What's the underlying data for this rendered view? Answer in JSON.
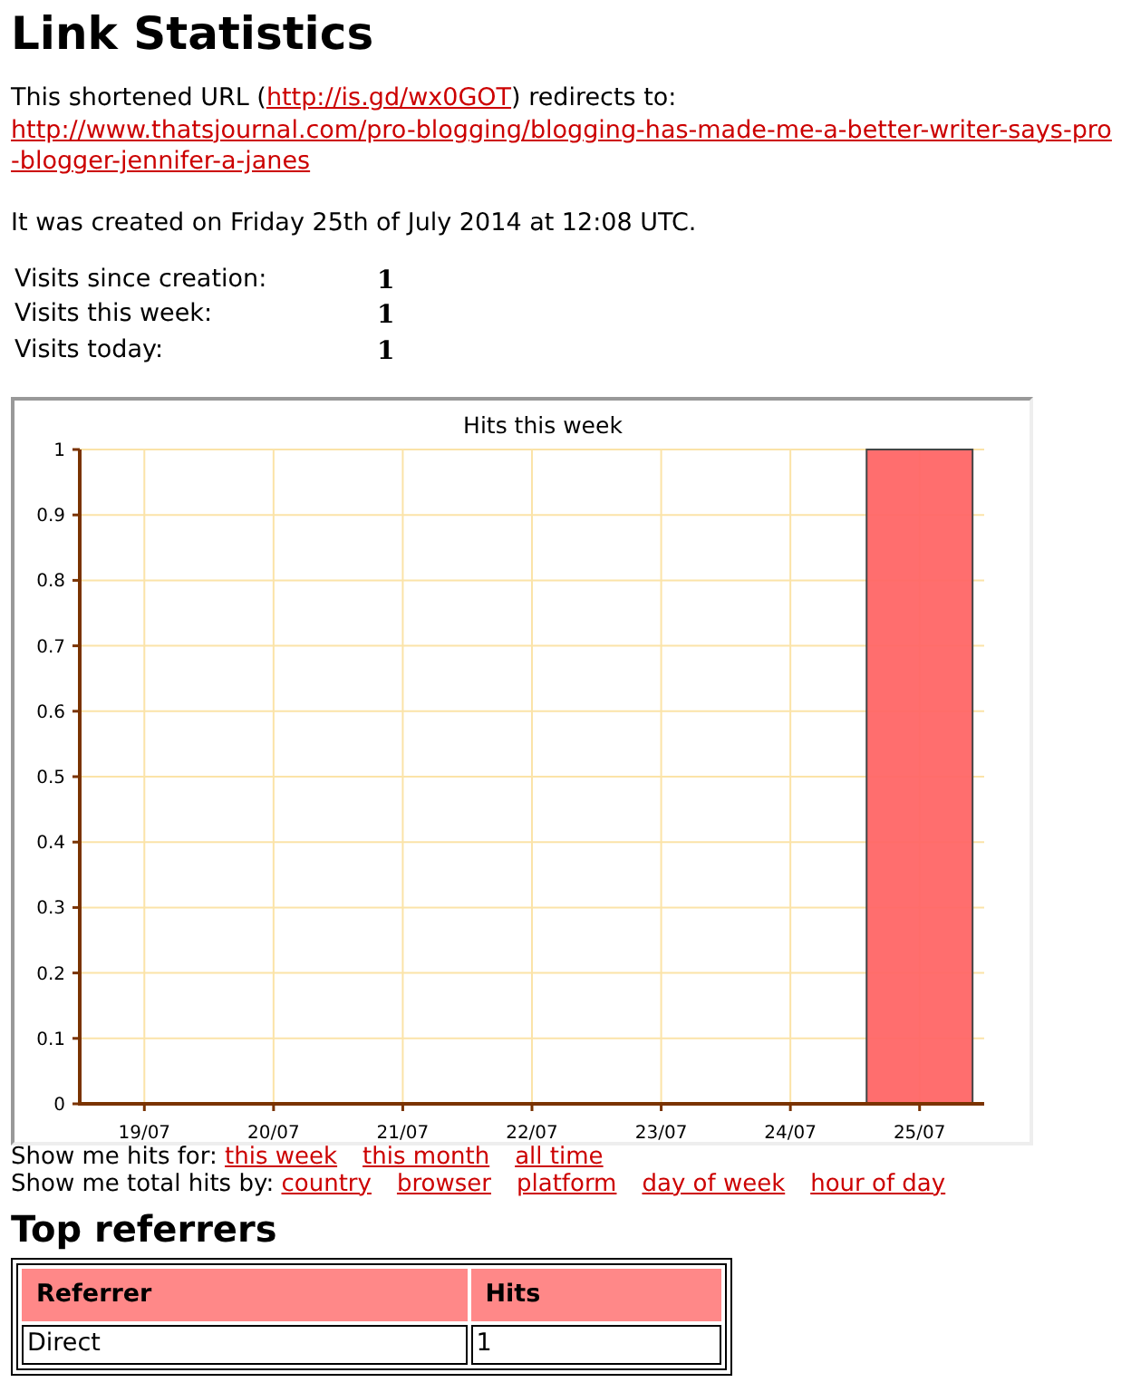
{
  "title": "Link Statistics",
  "intro": {
    "prefix": "This shortened URL (",
    "short_url": "http://is.gd/wx0GOT",
    "suffix": ") redirects to:",
    "target_url": "http://www.thatsjournal.com/pro-blogging/blogging-has-made-me-a-better-writer-says-pro-blogger-jennifer-a-janes"
  },
  "created": "It was created on Friday 25th of July 2014 at 12:08 UTC.",
  "stats": [
    {
      "label": "Visits since creation:",
      "value": "1"
    },
    {
      "label": "Visits this week:",
      "value": "1"
    },
    {
      "label": "Visits today:",
      "value": "1"
    }
  ],
  "chart": {
    "chart_data": {
      "type": "bar",
      "title": "Hits this week",
      "categories": [
        "19/07",
        "20/07",
        "21/07",
        "22/07",
        "23/07",
        "24/07",
        "25/07"
      ],
      "series": [
        {
          "color": "#ff6666",
          "values": [
            0,
            0,
            0,
            0,
            0,
            0,
            1
          ]
        }
      ],
      "grid": true,
      "ylim": [
        0,
        1
      ],
      "yticks": [
        0,
        {
          "value": 0.1,
          "label": "0.1"
        },
        {
          "value": 0.2,
          "label": "0.2"
        },
        {
          "value": 0.3,
          "label": "0.3"
        },
        {
          "value": 0.4,
          "label": "0.4"
        },
        {
          "value": 0.5,
          "label": "0.5"
        },
        {
          "value": 0.6,
          "label": "0.6"
        },
        {
          "value": 0.7,
          "label": "0.7"
        },
        {
          "value": 0.8,
          "label": "0.8"
        },
        {
          "value": 0.9,
          "label": "0.9"
        },
        1
      ]
    }
  },
  "hits_for": {
    "label": "Show me hits for:",
    "links": [
      "this week",
      "this month",
      "all time"
    ]
  },
  "total_by": {
    "label": "Show me total hits by:",
    "links": [
      "country",
      "browser",
      "platform",
      "day of week",
      "hour of day"
    ]
  },
  "referrers": {
    "title": "Top referrers",
    "columns": [
      "Referrer",
      "Hits"
    ],
    "rows": [
      [
        "Direct",
        "1"
      ]
    ]
  }
}
